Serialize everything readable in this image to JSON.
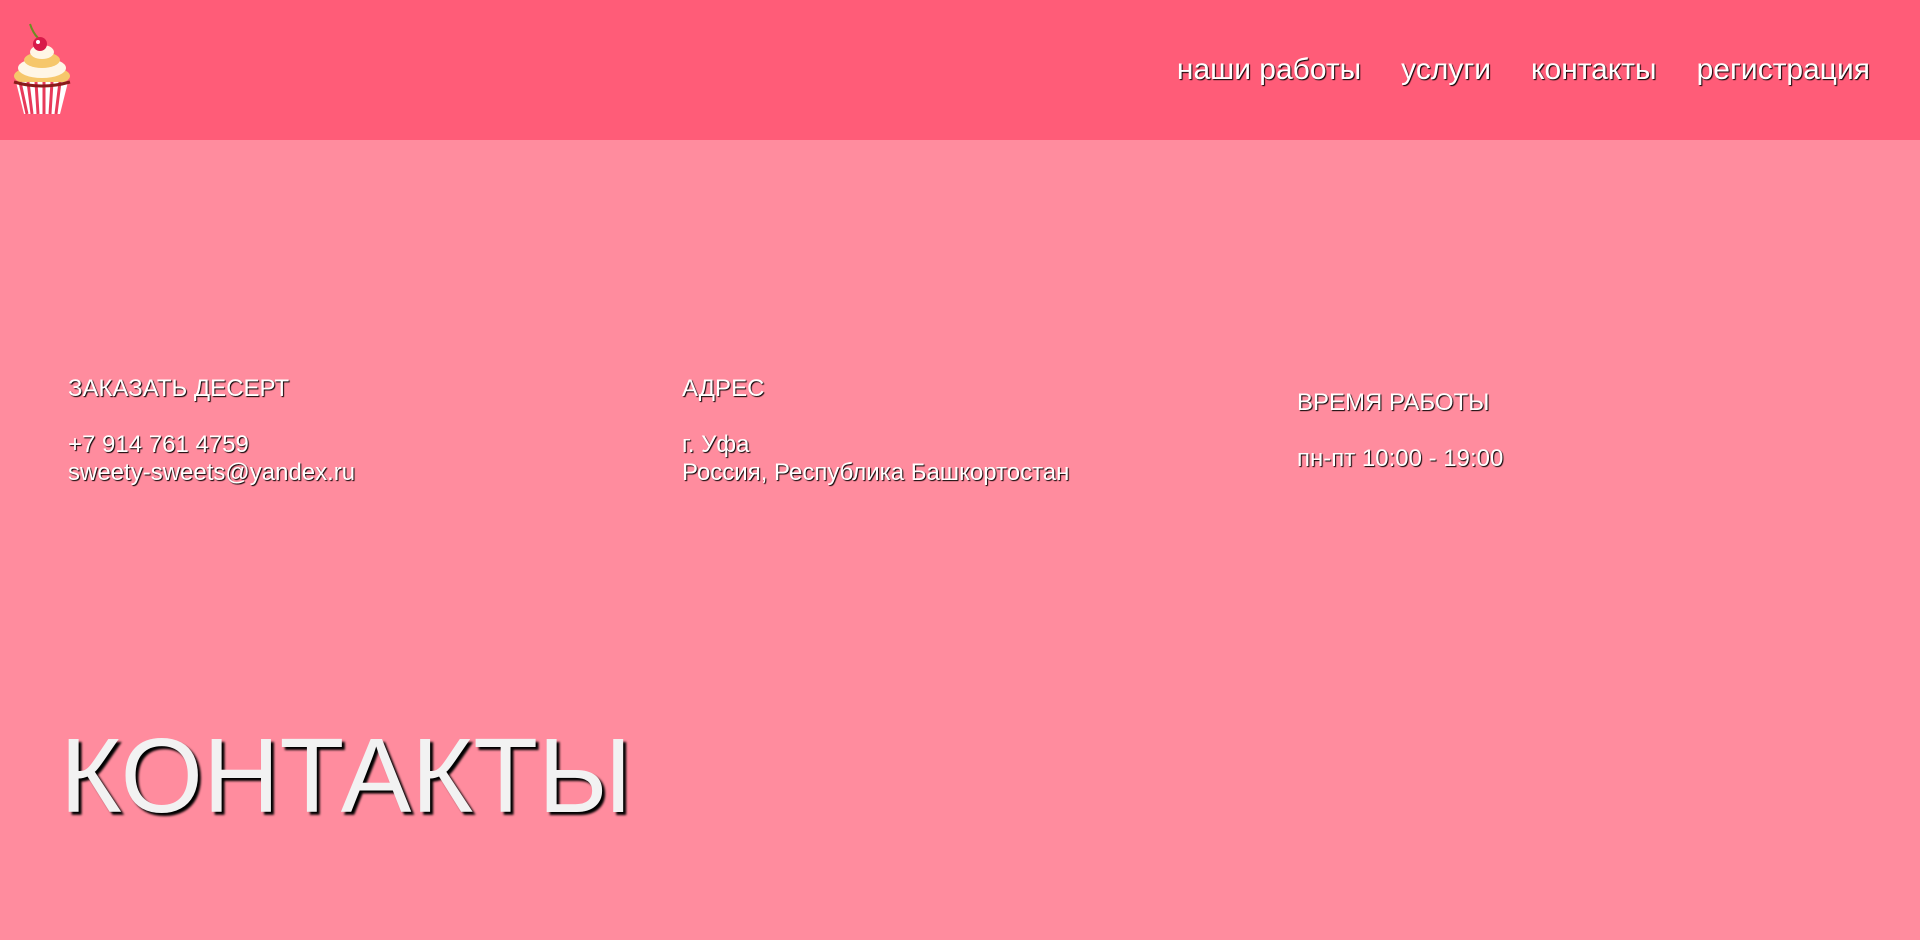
{
  "header": {
    "logo_icon": "cupcake-icon",
    "nav": [
      {
        "label": "наши работы"
      },
      {
        "label": "услуги"
      },
      {
        "label": "контакты"
      },
      {
        "label": "регистрация"
      }
    ]
  },
  "contacts": {
    "order": {
      "title": "ЗАКАЗАТЬ ДЕСЕРТ",
      "phone": "+7 914 761 4759",
      "email": "sweety-sweets@yandex.ru"
    },
    "address": {
      "title": "АДРЕС",
      "city": "г. Уфа",
      "region": "Россия, Республика Башкортостан"
    },
    "hours": {
      "title": "ВРЕМЯ РАБОТЫ",
      "schedule": "пн-пт 10:00 - 19:00"
    }
  },
  "page_title": "КОНТАКТЫ",
  "colors": {
    "header_bg": "#ff5c78",
    "page_bg": "#ff8c9e",
    "text": "#ffffff"
  }
}
